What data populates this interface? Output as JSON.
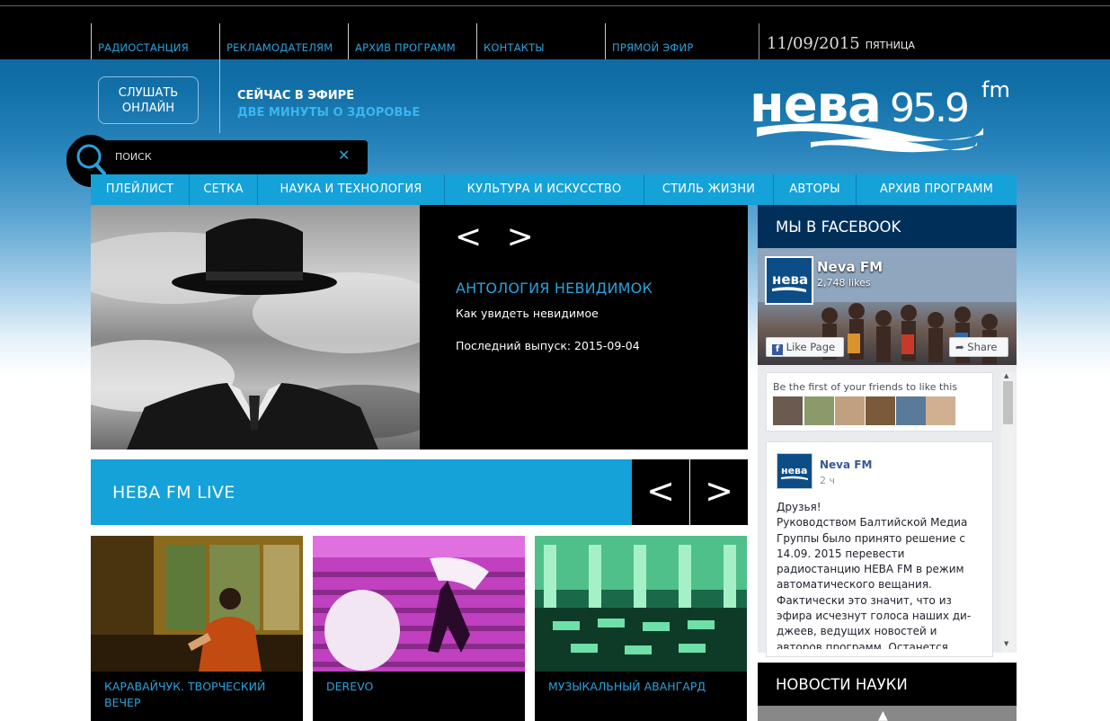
{
  "topnav": {
    "items": [
      "РАДИОСТАНЦИЯ",
      "РЕКЛАМОДАТЕЛЯМ",
      "АРХИВ ПРОГРАММ",
      "КОНТАКТЫ",
      "ПРЯМОЙ ЭФИР"
    ],
    "date": "11/09/2015",
    "weekday": "ПЯТНИЦА"
  },
  "header": {
    "listen_line1": "СЛУШАТЬ",
    "listen_line2": "ОНЛАЙН",
    "onair_label": "СЕЙЧАС В ЭФИРЕ",
    "onair_program": "ДВЕ МИНУТЫ О ЗДОРОВЬЕ",
    "logo_word": "нева",
    "logo_freq": "95.9",
    "logo_fm": "fm"
  },
  "search": {
    "placeholder": "ПОИСК",
    "clear_glyph": "✕"
  },
  "mainnav": {
    "items": [
      "ПЛЕЙЛИСТ",
      "СЕТКА",
      "НАУКА И ТЕХНОЛОГИЯ",
      "КУЛЬТУРА И ИСКУССТВО",
      "СТИЛЬ ЖИЗНИ",
      "АВТОРЫ",
      "АРХИВ ПРОГРАММ"
    ]
  },
  "hero": {
    "arrows": "< >",
    "title": "АНТОЛОГИЯ НЕВИДИМОК",
    "subtitle": "Как увидеть невидимое",
    "last_issue": "Последний выпуск: 2015-09-04"
  },
  "live": {
    "title": "НЕВА FM LIVE",
    "prev": "<",
    "next": ">"
  },
  "cards": [
    {
      "caption": "КАРАВАЙЧУК. ТВОРЧЕСКИЙ ВЕЧЕР"
    },
    {
      "caption": "DEREVO"
    },
    {
      "caption": "МУЗЫКАЛЬНЫЙ АВАНГАРД"
    }
  ],
  "facebook": {
    "heading": "МЫ В FACEBOOK",
    "page_name": "Neva FM",
    "likes": "2,748 likes",
    "like_button": "Like Page",
    "share_button": "Share",
    "friends_text": "Be the first of your friends to like this",
    "logo_text": "нева",
    "post": {
      "author": "Neva FM",
      "time": "2 ч",
      "text": "Друзья!\nРуководством Балтийской Медиа Группы было принято решение с 14.09. 2015 перевести радиостанцию НЕВА FM в режим автоматического вещания. Фактически это значит, что из эфира исчезнут голоса наших ди-джеев, ведущих новостей и авторов программ. Останется много музыки. Спасибо, что слушали, советовали и"
    }
  },
  "science": {
    "heading": "НОВОСТИ НАУКИ"
  },
  "colors": {
    "accent": "#14a2d9",
    "link": "#2aa2dc",
    "fb_header": "#00305a"
  }
}
